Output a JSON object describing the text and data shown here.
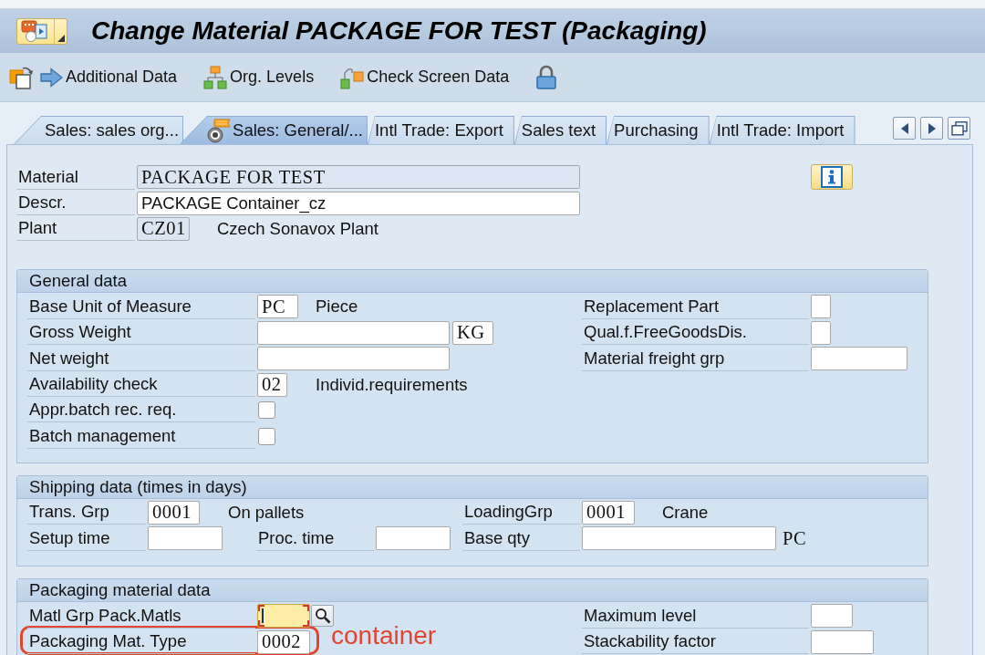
{
  "window": {
    "title": "Change Material PACKAGE FOR TEST (Packaging)"
  },
  "toolbar": {
    "buttons": [
      {
        "label": "Additional Data"
      },
      {
        "label": "Org. Levels"
      },
      {
        "label": "Check Screen Data"
      }
    ]
  },
  "tabs": [
    {
      "label": "Sales: sales org...",
      "selected": false
    },
    {
      "label": "Sales: General/...",
      "selected": true
    },
    {
      "label": "Intl Trade: Export",
      "selected": false
    },
    {
      "label": "Sales text",
      "selected": false
    },
    {
      "label": "Purchasing",
      "selected": false
    },
    {
      "label": "Intl Trade: Import",
      "selected": false
    }
  ],
  "header": {
    "fields": [
      {
        "label": "Material",
        "kind": "code",
        "value": "PACKAGE FOR TEST",
        "readonly": true
      },
      {
        "label": "Descr.",
        "kind": "text",
        "value": "PACKAGE Container_cz",
        "readonly": false
      },
      {
        "label": "Plant",
        "kind": "code",
        "value": "CZ01",
        "readonly": true,
        "description": "Czech Sonavox Plant"
      }
    ]
  },
  "general_data": {
    "title": "General data",
    "left": [
      {
        "label": "Base Unit of Measure",
        "kind": "code",
        "value": "PC",
        "description": "Piece"
      },
      {
        "label": "Gross Weight",
        "kind": "code",
        "unit_field": "KG"
      },
      {
        "label": "Net weight",
        "kind": "code"
      },
      {
        "label": "Availability check",
        "kind": "code",
        "value": "02",
        "description": "Individ.requirements"
      },
      {
        "label": "Appr.batch rec. req.",
        "kind": "checkbox",
        "checked": false
      },
      {
        "label": "Batch management",
        "kind": "checkbox",
        "checked": false
      }
    ],
    "right": [
      {
        "label": "Replacement Part",
        "kind": "code"
      },
      {
        "label": "Qual.f.FreeGoodsDis.",
        "kind": "code"
      },
      {
        "label": "Material freight grp",
        "kind": "code"
      }
    ]
  },
  "shipping_data": {
    "title": "Shipping data (times in days)",
    "rows": [
      [
        {
          "label": "Trans. Grp",
          "kind": "code",
          "value": "0001",
          "description": "On pallets"
        },
        "",
        {
          "label": "LoadingGrp",
          "kind": "code",
          "value": "0001",
          "description": "Crane"
        }
      ],
      [
        {
          "label": "Setup time",
          "kind": "code"
        },
        {
          "label": "Proc. time",
          "kind": "code"
        },
        {
          "label": "Base qty",
          "kind": "code",
          "unit": "PC"
        }
      ]
    ]
  },
  "packaging_data": {
    "title": "Packaging material data",
    "left": [
      {
        "label": "Matl Grp Pack.Matls",
        "kind": "code",
        "focused": true
      },
      {
        "label": "Packaging Mat. Type",
        "kind": "code",
        "value": "0002",
        "focused": false
      }
    ],
    "right": [
      {
        "label": "Maximum level",
        "kind": "code"
      },
      {
        "label": "Stackability factor",
        "kind": "code"
      }
    ]
  },
  "annotation": {
    "text": "container"
  }
}
